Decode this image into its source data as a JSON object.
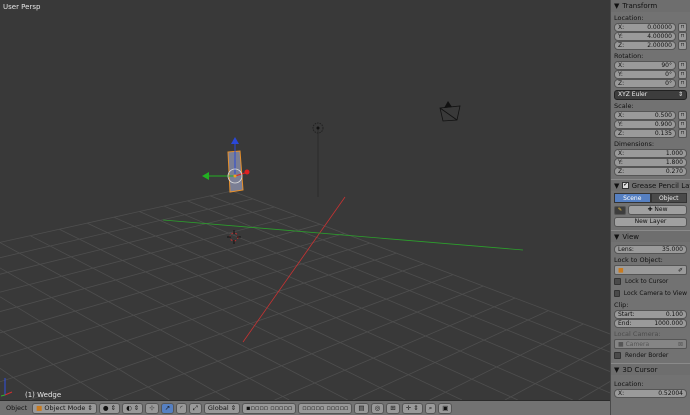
{
  "viewport": {
    "title": "User Persp",
    "object_label": "(1) Wedge"
  },
  "header": {
    "menu": "Object",
    "mode": "Object Mode",
    "orientation": "Global"
  },
  "panel": {
    "transform": {
      "title": "Transform",
      "location_label": "Location:",
      "location": [
        {
          "axis": "X:",
          "value": "0.00000"
        },
        {
          "axis": "Y:",
          "value": "4.00000"
        },
        {
          "axis": "Z:",
          "value": "2.00000"
        }
      ],
      "rotation_label": "Rotation:",
      "rotation": [
        {
          "axis": "X:",
          "value": "90°"
        },
        {
          "axis": "Y:",
          "value": "0°"
        },
        {
          "axis": "Z:",
          "value": "0°"
        }
      ],
      "rotation_mode": "XYZ Euler",
      "scale_label": "Scale:",
      "scale": [
        {
          "axis": "X:",
          "value": "0.500"
        },
        {
          "axis": "Y:",
          "value": "0.900"
        },
        {
          "axis": "Z:",
          "value": "0.135"
        }
      ],
      "dimensions_label": "Dimensions:",
      "dimensions": [
        {
          "axis": "X:",
          "value": "1.000"
        },
        {
          "axis": "Y:",
          "value": "1.800"
        },
        {
          "axis": "Z:",
          "value": "0.270"
        }
      ]
    },
    "grease": {
      "title": "Grease Pencil Layers",
      "checked": true,
      "tab_scene": "Scene",
      "tab_object": "Object",
      "new": "New",
      "new_layer": "New Layer"
    },
    "view": {
      "title": "View",
      "lens_label": "Lens:",
      "lens": "35.000",
      "lock_object_label": "Lock to Object:",
      "lock_cursor": "Lock to Cursor",
      "lock_camera": "Lock Camera to View",
      "clip_label": "Clip:",
      "start_label": "Start:",
      "start": "0.100",
      "end_label": "End:",
      "end": "1000.000",
      "local_camera_label": "Local Camera:",
      "camera": "Camera",
      "render_border": "Render Border"
    },
    "cursor": {
      "title": "3D Cursor",
      "location_label": "Location:",
      "x_label": "X:",
      "x": "0.52004"
    }
  },
  "colors": {
    "bg": "#393939",
    "panel": "#727272",
    "selected": "#5680c2",
    "x_axis": "#c83232",
    "y_axis": "#2ca02c",
    "selection": "#e8902a"
  }
}
